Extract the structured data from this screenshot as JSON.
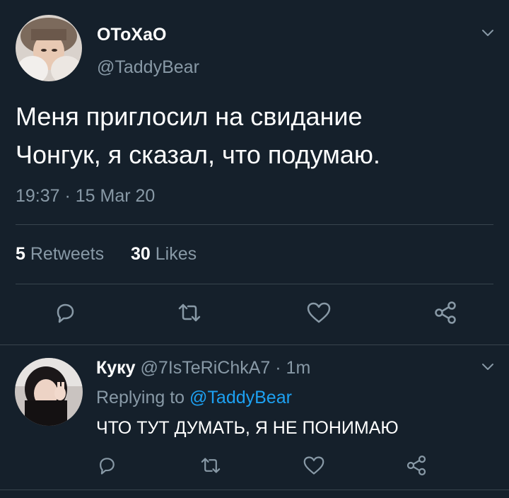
{
  "tweet": {
    "display_name": "ОТоХаО",
    "handle": "@TaddyBear",
    "text_line1": "Меня приглосил на свидание",
    "text_line2": "Чонгук, я сказал, что подумаю.",
    "timestamp": "19:37 · 15 Mar 20",
    "retweets_count": "5",
    "retweets_label": "Retweets",
    "likes_count": "30",
    "likes_label": "Likes"
  },
  "reply": {
    "display_name": "Куку",
    "handle": "@7IsTeRiChkA7",
    "time": "· 1m",
    "replying_prefix": "Replying to",
    "replying_handle": "@TaddyBear",
    "text": "ЧТО ТУТ ДУМАТЬ, Я НЕ ПОНИМАЮ"
  },
  "colors": {
    "background": "#15202b",
    "muted": "#8899a6",
    "link": "#1da1f2",
    "divider": "#38444d"
  },
  "icons": [
    "reply-icon",
    "retweet-icon",
    "like-icon",
    "share-icon",
    "chevron-down-icon"
  ]
}
